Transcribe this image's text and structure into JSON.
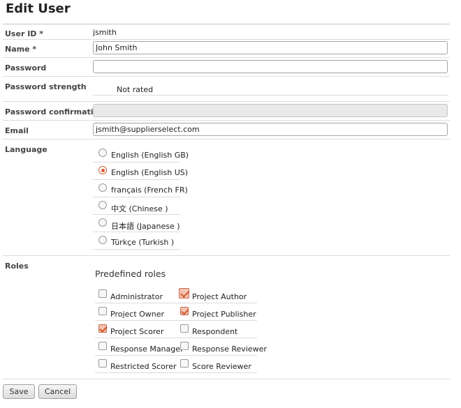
{
  "page": {
    "title": "Edit User"
  },
  "fields": {
    "user_id": {
      "label": "User ID *",
      "value": "jsmith"
    },
    "name": {
      "label": "Name *",
      "value": "John Smith"
    },
    "password": {
      "label": "Password",
      "value": ""
    },
    "password_strength": {
      "label": "Password strength",
      "value": "Not rated"
    },
    "password_confirmation": {
      "label": "Password confirmation",
      "value": ""
    },
    "email": {
      "label": "Email",
      "value": "jsmith@supplierselect.com"
    }
  },
  "language": {
    "label": "Language",
    "options": [
      {
        "label": "English (English GB)",
        "selected": false
      },
      {
        "label": "English (English US)",
        "selected": true
      },
      {
        "label": "français (French FR)",
        "selected": false
      },
      {
        "label": "中文 (Chinese )",
        "selected": false
      },
      {
        "label": "日本語 (Japanese )",
        "selected": false
      },
      {
        "label": "Türkçe (Turkish )",
        "selected": false
      }
    ]
  },
  "roles": {
    "label": "Roles",
    "heading": "Predefined roles",
    "items": [
      {
        "label": "Administrator",
        "checked": false
      },
      {
        "label": "Project Author",
        "checked": true
      },
      {
        "label": "Project Owner",
        "checked": false
      },
      {
        "label": "Project Publisher",
        "checked": true
      },
      {
        "label": "Project Scorer",
        "checked": true
      },
      {
        "label": "Respondent",
        "checked": false
      },
      {
        "label": "Response Manager",
        "checked": false
      },
      {
        "label": "Response Reviewer",
        "checked": false
      },
      {
        "label": "Restricted Scorer",
        "checked": false
      },
      {
        "label": "Score Reviewer",
        "checked": false
      }
    ]
  },
  "buttons": {
    "save": "Save",
    "cancel": "Cancel"
  },
  "colors": {
    "accent": "#e4582a",
    "rule": "#b9c7d3"
  }
}
